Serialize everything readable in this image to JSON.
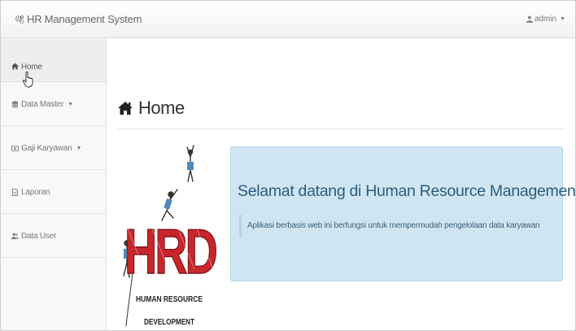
{
  "navbar": {
    "brand": "HR Management System",
    "brand_icon": "gears-icon",
    "user": "admin",
    "user_icon": "user-icon"
  },
  "sidebar": {
    "items": [
      {
        "label": "Home",
        "icon": "home-icon",
        "dropdown": false,
        "active": true
      },
      {
        "label": "Data Master",
        "icon": "database-icon",
        "dropdown": true
      },
      {
        "label": "Gaji Karyawan",
        "icon": "money-icon",
        "dropdown": true
      },
      {
        "label": "Laporan",
        "icon": "file-icon",
        "dropdown": false
      },
      {
        "label": "Data User",
        "icon": "users-icon",
        "dropdown": false
      }
    ]
  },
  "page": {
    "title": "Home",
    "title_icon": "home-icon"
  },
  "logo": {
    "letters": "HRD",
    "line1": "HUMAN RESOURCE",
    "line2": "DEVELOPMENT"
  },
  "jumbotron": {
    "heading": "Selamat datang di Human Resource Management System",
    "text": "Aplikasi berbasis web ini berfungsi untuk mempermudah pengelolaan data karyawan"
  },
  "colors": {
    "jumbotron_bg": "#cfe6f2",
    "heading": "#2b5c7e",
    "logo_red": "#c9262b"
  }
}
